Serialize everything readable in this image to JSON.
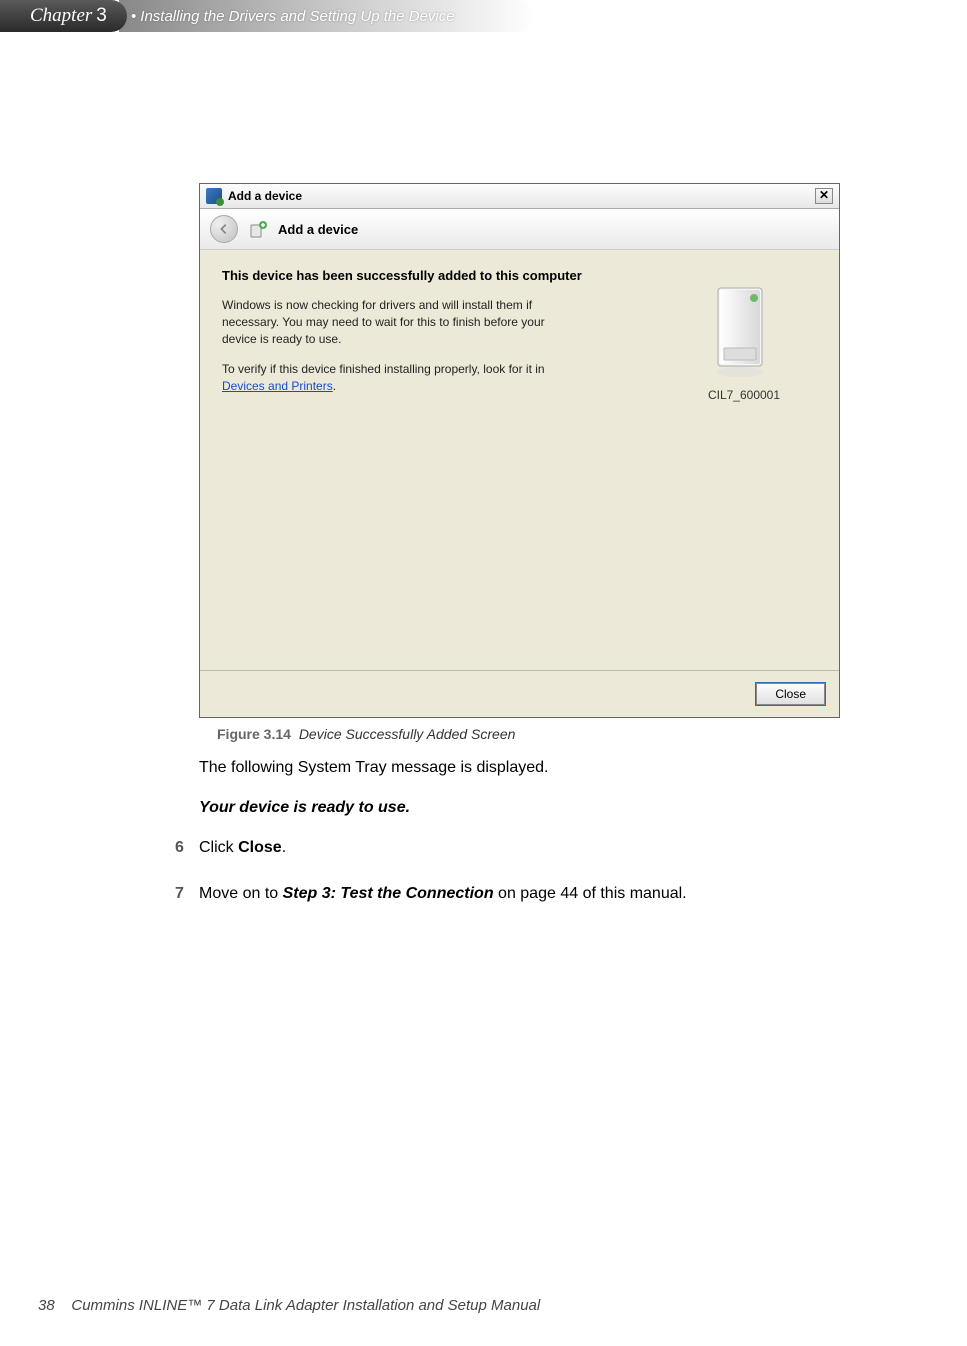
{
  "header": {
    "chapter_word": "Chapter",
    "chapter_num": "3",
    "chapter_title": "• Installing the Drivers and Setting Up the Device"
  },
  "screenshot": {
    "titlebar_text": "Add a device",
    "nav_title": "Add a device",
    "success_heading": "This device has been successfully added to this computer",
    "body_para1": "Windows is now checking for drivers and will install them if necessary. You may need to wait for this to finish before your device is ready to use.",
    "body_para2_prefix": "To verify if this device finished installing properly, look for it in ",
    "link_text": "Devices and Printers",
    "body_para2_suffix": ".",
    "device_name": "CIL7_600001",
    "close_button": "Close"
  },
  "figure": {
    "label": "Figure 3.14",
    "caption": "Device Successfully Added Screen"
  },
  "content": {
    "para_system_tray": "The following System Tray message is displayed.",
    "para_ready": "Your device is ready to use.",
    "steps": [
      {
        "num": "6",
        "text_prefix": "Click ",
        "bold": "Close",
        "text_suffix": "."
      },
      {
        "num": "7",
        "text_prefix": "Move on to ",
        "bold": "Step 3: Test the Connection",
        "text_suffix": " on page 44 of this manual."
      }
    ]
  },
  "footer": {
    "page_num": "38",
    "manual_title": "Cummins INLINE™ 7 Data Link Adapter Installation and Setup Manual"
  }
}
